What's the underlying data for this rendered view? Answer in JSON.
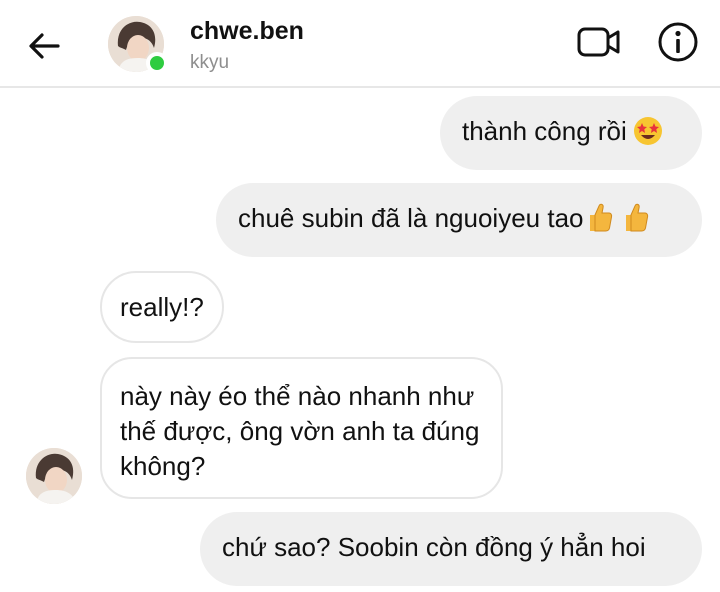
{
  "header": {
    "username": "chwe.ben",
    "subtitle": "kkyu"
  },
  "messages": [
    {
      "direction": "outgoing",
      "text": "thành công rồi",
      "emoji": "star-struck-emoji"
    },
    {
      "direction": "outgoing",
      "text": "chuê subin đã là nguoiyeu tao",
      "emoji": "thumbs-up-emoji x2"
    },
    {
      "direction": "incoming",
      "text": "really!?"
    },
    {
      "direction": "incoming",
      "text": "này này éo thể nào nhanh như thế được, ông vờn anh ta đúng không?"
    },
    {
      "direction": "outgoing",
      "text": "chứ sao? Soobin còn đồng ý hẳn hoi"
    }
  ],
  "colors": {
    "outgoing_bubble": "#efefef",
    "incoming_bubble": "#ffffff",
    "online_indicator": "#2ecc40"
  },
  "icons": [
    "back-arrow-icon",
    "video-call-icon",
    "info-icon"
  ]
}
